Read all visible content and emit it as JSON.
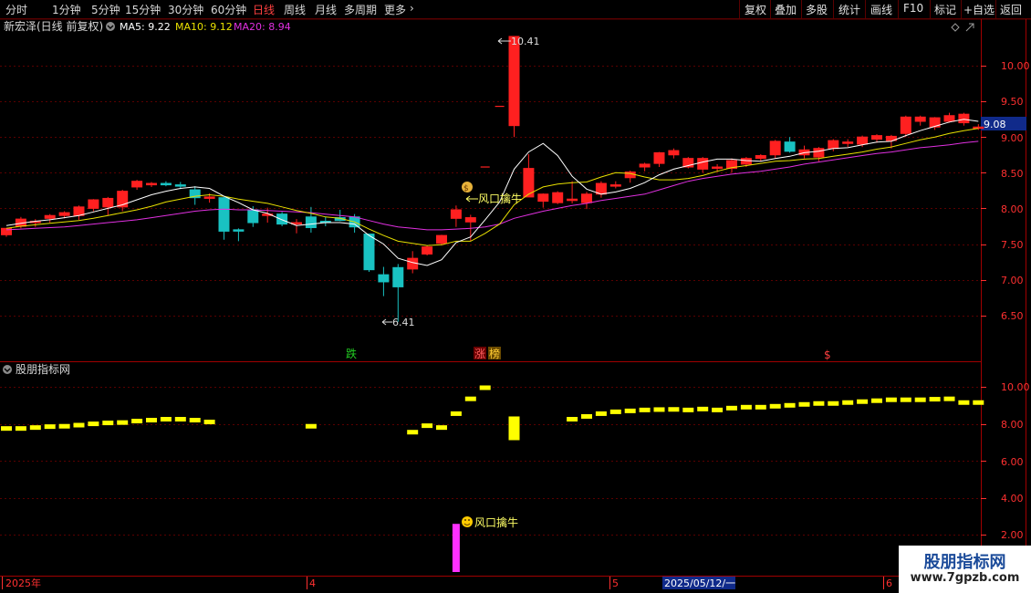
{
  "toolbar": {
    "periods": [
      "分时",
      "1分钟",
      "5分钟",
      "15分钟",
      "30分钟",
      "60分钟",
      "日线",
      "周线",
      "月线",
      "多周期",
      "更多"
    ],
    "active_period": "日线",
    "more_arrow": "›",
    "tools": [
      "复权",
      "叠加",
      "多股",
      "统计",
      "画线",
      "F10",
      "标记",
      "+自选",
      "返回"
    ]
  },
  "header": {
    "stock_label": "新宏泽(日线 前复权)",
    "ma5": "MA5: 9.22",
    "ma10": "MA10: 9.12",
    "ma20": "MA20: 8.94"
  },
  "colors": {
    "up": "#ff2020",
    "down": "#19c2c2",
    "ma5": "#ffffff",
    "ma10": "#e8e000",
    "ma20": "#e030e0",
    "grid": "#5a0000",
    "axis_text": "#ff3030",
    "indicator_bar": "#ffff00",
    "signal_bar": "#ff30ff"
  },
  "main_axis": {
    "ticks": [
      "10.00",
      "9.50",
      "9.00",
      "8.50",
      "8.00",
      "7.50",
      "7.00",
      "6.50"
    ],
    "current_price": "9.08"
  },
  "indicator_axis": {
    "ticks": [
      "10.00",
      "8.00",
      "6.00",
      "4.00",
      "2.00"
    ]
  },
  "annotations": {
    "high_label": "10.41",
    "low_label": "6.41",
    "main_signal": "风口擒牛",
    "sub_signal": "风口擒牛",
    "drop_tag": "跌",
    "limit_tag1": "涨",
    "limit_tag2": "榜",
    "money_tag": "$"
  },
  "indicator_panel": {
    "title": "股朋指标网"
  },
  "date_axis": {
    "year_label": "2025年",
    "month_4": "4",
    "month_5": "5",
    "cursor_date": "2025/05/12/一",
    "month_6": "6"
  },
  "watermark": {
    "title": "股朋指标网",
    "url": "www.7gpzb.com"
  },
  "chart_data": {
    "type": "candlestick",
    "price_range": [
      6.0,
      10.6
    ],
    "indicator_range": [
      1.0,
      11.0
    ],
    "candles": [
      [
        7.63,
        7.72,
        7.6,
        7.72
      ],
      [
        7.75,
        7.88,
        7.72,
        7.85
      ],
      [
        7.8,
        7.85,
        7.74,
        7.82
      ],
      [
        7.86,
        7.92,
        7.8,
        7.9
      ],
      [
        7.9,
        7.96,
        7.86,
        7.94
      ],
      [
        7.9,
        8.04,
        7.84,
        8.02
      ],
      [
        8.0,
        8.13,
        7.96,
        8.12
      ],
      [
        8.02,
        8.16,
        7.9,
        8.14
      ],
      [
        8.02,
        8.26,
        7.96,
        8.24
      ],
      [
        8.3,
        8.4,
        8.26,
        8.38
      ],
      [
        8.33,
        8.37,
        8.3,
        8.35
      ],
      [
        8.35,
        8.38,
        8.31,
        8.33
      ],
      [
        8.33,
        8.37,
        8.27,
        8.32
      ],
      [
        8.26,
        8.31,
        8.05,
        8.15
      ],
      [
        8.14,
        8.21,
        8.08,
        8.16
      ],
      [
        8.15,
        8.16,
        7.56,
        7.68
      ],
      [
        7.7,
        7.72,
        7.54,
        7.69
      ],
      [
        7.98,
        8.03,
        7.74,
        7.8
      ],
      [
        7.9,
        8.01,
        7.8,
        7.92
      ],
      [
        7.92,
        7.95,
        7.75,
        7.78
      ],
      [
        7.8,
        7.85,
        7.65,
        7.8
      ],
      [
        7.88,
        8.02,
        7.66,
        7.73
      ],
      [
        7.82,
        7.88,
        7.75,
        7.8
      ],
      [
        7.87,
        7.98,
        7.82,
        7.83
      ],
      [
        7.88,
        7.92,
        7.66,
        7.74
      ],
      [
        7.64,
        7.64,
        7.11,
        7.14
      ],
      [
        7.07,
        7.18,
        6.77,
        6.97
      ],
      [
        7.17,
        7.22,
        6.41,
        6.9
      ],
      [
        7.15,
        7.4,
        7.09,
        7.3
      ],
      [
        7.36,
        7.48,
        7.34,
        7.46
      ],
      [
        7.51,
        7.63,
        7.48,
        7.62
      ],
      [
        7.86,
        8.04,
        7.74,
        7.98
      ],
      [
        7.81,
        7.91,
        7.54,
        7.87
      ],
      [
        8.58,
        8.58,
        8.58,
        8.58
      ],
      [
        9.43,
        9.43,
        9.43,
        9.43
      ],
      [
        9.16,
        10.41,
        9.0,
        10.41
      ],
      [
        8.16,
        8.76,
        8.16,
        8.56
      ],
      [
        8.1,
        8.21,
        8.01,
        8.2
      ],
      [
        8.08,
        8.24,
        8.06,
        8.22
      ],
      [
        8.11,
        8.38,
        8.07,
        8.13
      ],
      [
        8.08,
        8.23,
        7.99,
        8.2
      ],
      [
        8.2,
        8.38,
        8.15,
        8.35
      ],
      [
        8.32,
        8.38,
        8.28,
        8.33
      ],
      [
        8.43,
        8.53,
        8.36,
        8.51
      ],
      [
        8.58,
        8.64,
        8.52,
        8.62
      ],
      [
        8.63,
        8.79,
        8.58,
        8.78
      ],
      [
        8.75,
        8.84,
        8.7,
        8.81
      ],
      [
        8.58,
        8.72,
        8.56,
        8.7
      ],
      [
        8.55,
        8.72,
        8.5,
        8.7
      ],
      [
        8.57,
        8.62,
        8.51,
        8.58
      ],
      [
        8.56,
        8.7,
        8.5,
        8.67
      ],
      [
        8.62,
        8.72,
        8.58,
        8.7
      ],
      [
        8.7,
        8.76,
        8.66,
        8.74
      ],
      [
        8.75,
        8.96,
        8.7,
        8.94
      ],
      [
        8.93,
        9.0,
        8.78,
        8.8
      ],
      [
        8.75,
        8.88,
        8.7,
        8.82
      ],
      [
        8.72,
        8.86,
        8.66,
        8.84
      ],
      [
        8.84,
        8.97,
        8.8,
        8.95
      ],
      [
        8.91,
        8.97,
        8.86,
        8.93
      ],
      [
        8.9,
        9.02,
        8.86,
        9.0
      ],
      [
        8.97,
        9.04,
        8.92,
        9.02
      ],
      [
        8.95,
        9.03,
        8.84,
        9.01
      ],
      [
        9.05,
        9.3,
        9.0,
        9.28
      ],
      [
        9.22,
        9.3,
        9.16,
        9.28
      ],
      [
        9.14,
        9.28,
        9.1,
        9.27
      ],
      [
        9.22,
        9.34,
        9.2,
        9.3
      ],
      [
        9.2,
        9.34,
        9.16,
        9.32
      ],
      [
        9.14,
        9.18,
        9.1,
        9.14
      ]
    ],
    "ma5": [
      7.76,
      7.79,
      7.82,
      7.84,
      7.87,
      7.9,
      7.95,
      8.0,
      8.05,
      8.12,
      8.19,
      8.24,
      8.28,
      8.3,
      8.28,
      8.17,
      8.08,
      7.98,
      7.93,
      7.84,
      7.76,
      7.78,
      7.8,
      7.8,
      7.78,
      7.62,
      7.5,
      7.3,
      7.24,
      7.2,
      7.28,
      7.52,
      7.6,
      7.84,
      8.09,
      8.55,
      8.79,
      8.91,
      8.74,
      8.45,
      8.27,
      8.2,
      8.23,
      8.28,
      8.36,
      8.47,
      8.55,
      8.6,
      8.65,
      8.69,
      8.69,
      8.67,
      8.66,
      8.7,
      8.73,
      8.78,
      8.8,
      8.84,
      8.85,
      8.89,
      8.93,
      8.94,
      9.02,
      9.09,
      9.15,
      9.21,
      9.25,
      9.22
    ],
    "ma10": [
      7.72,
      7.75,
      7.77,
      7.79,
      7.81,
      7.83,
      7.86,
      7.9,
      7.94,
      7.98,
      8.03,
      8.09,
      8.13,
      8.17,
      8.19,
      8.17,
      8.13,
      8.1,
      8.07,
      8.02,
      7.97,
      7.93,
      7.88,
      7.86,
      7.81,
      7.71,
      7.62,
      7.54,
      7.51,
      7.48,
      7.49,
      7.54,
      7.54,
      7.65,
      7.78,
      8.05,
      8.2,
      8.3,
      8.34,
      8.36,
      8.37,
      8.44,
      8.5,
      8.49,
      8.44,
      8.4,
      8.4,
      8.42,
      8.46,
      8.52,
      8.57,
      8.6,
      8.63,
      8.66,
      8.67,
      8.69,
      8.7,
      8.73,
      8.76,
      8.79,
      8.83,
      8.86,
      8.91,
      8.96,
      9.0,
      9.05,
      9.09,
      9.12
    ],
    "ma20": [
      7.7,
      7.71,
      7.72,
      7.73,
      7.74,
      7.76,
      7.78,
      7.8,
      7.82,
      7.84,
      7.87,
      7.9,
      7.93,
      7.96,
      7.98,
      7.99,
      7.98,
      7.98,
      7.97,
      7.96,
      7.95,
      7.94,
      7.92,
      7.9,
      7.88,
      7.83,
      7.78,
      7.74,
      7.72,
      7.7,
      7.7,
      7.71,
      7.72,
      7.74,
      7.78,
      7.86,
      7.91,
      7.96,
      8.0,
      8.04,
      8.07,
      8.11,
      8.14,
      8.17,
      8.2,
      8.26,
      8.32,
      8.38,
      8.42,
      8.45,
      8.48,
      8.5,
      8.52,
      8.55,
      8.58,
      8.62,
      8.65,
      8.68,
      8.71,
      8.74,
      8.77,
      8.79,
      8.82,
      8.85,
      8.87,
      8.89,
      8.92,
      8.94
    ],
    "indicator": [
      7.8,
      7.8,
      7.85,
      7.9,
      7.92,
      7.98,
      8.05,
      8.1,
      8.12,
      8.2,
      8.25,
      8.3,
      8.3,
      8.25,
      8.15,
      null,
      null,
      null,
      null,
      null,
      null,
      7.92,
      null,
      null,
      null,
      null,
      null,
      null,
      7.6,
      7.95,
      7.85,
      8.6,
      9.4,
      10.0,
      null,
      8.4,
      null,
      null,
      null,
      8.3,
      8.45,
      8.6,
      8.7,
      8.75,
      8.8,
      8.82,
      8.83,
      8.8,
      8.85,
      8.8,
      8.9,
      8.95,
      8.95,
      9.0,
      9.05,
      9.1,
      9.15,
      9.15,
      9.2,
      9.25,
      9.3,
      9.35,
      9.35,
      9.35,
      9.38,
      9.4,
      9.2,
      9.2
    ],
    "indicator_signal_index": 31,
    "indicator_signal_value": 2.6
  }
}
